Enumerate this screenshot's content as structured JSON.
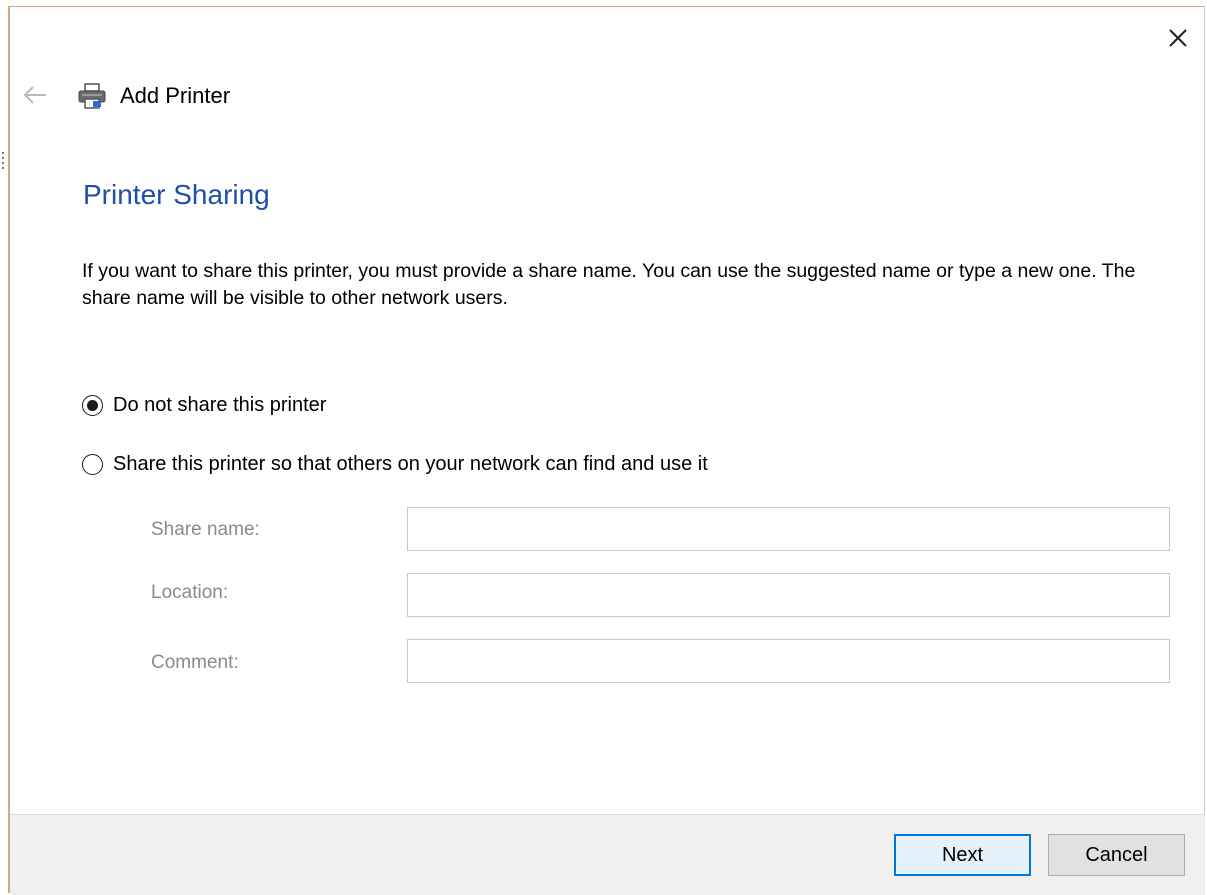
{
  "window": {
    "title": "Add Printer",
    "close_icon": "close-icon",
    "back_icon": "back-arrow-icon",
    "app_icon": "printer-icon"
  },
  "page": {
    "heading": "Printer Sharing",
    "description": "If you want to share this printer, you must provide a share name. You can use the suggested name or type a new one. The share name will be visible to other network users."
  },
  "options": [
    {
      "label": "Do not share this printer",
      "selected": true
    },
    {
      "label": "Share this printer so that others on your network can find and use it",
      "selected": false
    }
  ],
  "fields": {
    "share_name": {
      "label": "Share name:",
      "value": ""
    },
    "location": {
      "label": "Location:",
      "value": ""
    },
    "comment": {
      "label": "Comment:",
      "value": ""
    }
  },
  "buttons": {
    "next": "Next",
    "cancel": "Cancel"
  },
  "colors": {
    "heading": "#1f4fa8",
    "accent_border": "#0078d7",
    "footer_bg": "#f0f0f0",
    "disabled_label": "#8a8a8a"
  }
}
